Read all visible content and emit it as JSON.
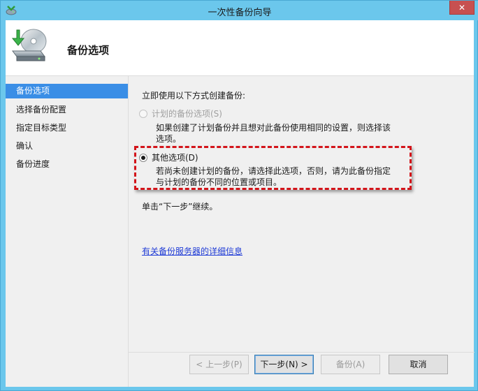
{
  "window": {
    "title": "一次性备份向导",
    "close_label": "✕"
  },
  "header": {
    "title": "备份选项",
    "icon": "backup-drive-icon"
  },
  "sidebar": {
    "items": [
      {
        "label": "备份选项",
        "active": true
      },
      {
        "label": "选择备份配置",
        "active": false
      },
      {
        "label": "指定目标类型",
        "active": false
      },
      {
        "label": "确认",
        "active": false
      },
      {
        "label": "备份进度",
        "active": false
      }
    ]
  },
  "main": {
    "prompt": "立即使用以下方式创建备份:",
    "option_scheduled": {
      "label": "计划的备份选项(S)",
      "enabled": false,
      "checked": false,
      "description": "如果创建了计划备份并且想对此备份使用相同的设置，则选择该选项。"
    },
    "option_other": {
      "label": "其他选项(D)",
      "enabled": true,
      "checked": true,
      "description": "若尚未创建计划的备份，请选择此选项，否则，请为此备份指定与计划的备份不同的位置或项目。"
    },
    "continue_text": "单击“下一步”继续。",
    "link_text": "有关备份服务器的详细信息"
  },
  "buttons": {
    "back": "< 上一步(P)",
    "next": "下一步(N) >",
    "backup": "备份(A)",
    "cancel": "取消"
  },
  "colors": {
    "titlebar": "#6bc7ec",
    "selection": "#3a8ee6",
    "highlight": "#d3141a",
    "link": "#1f3bd6"
  }
}
